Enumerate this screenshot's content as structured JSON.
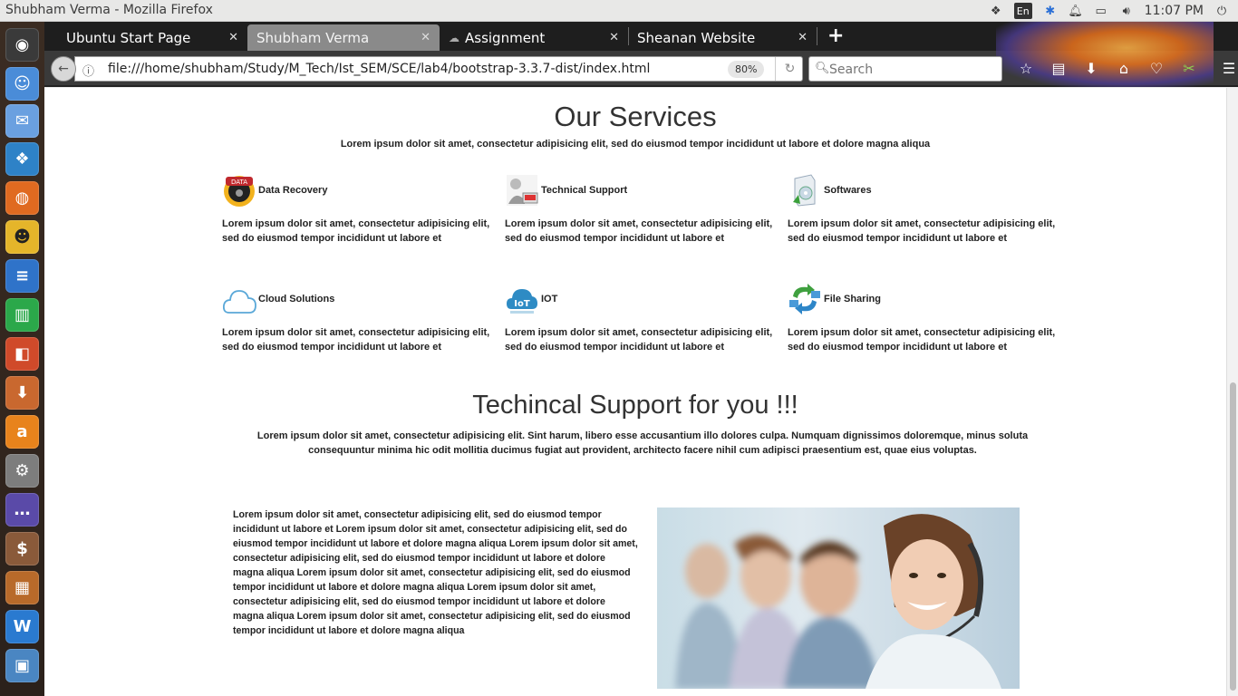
{
  "window": {
    "title": "Shubham Verma - Mozilla Firefox",
    "keyboard": "En",
    "clock": "11:07 PM"
  },
  "tabs": [
    {
      "label": "Ubuntu Start Page",
      "active": false
    },
    {
      "label": "Shubham Verma",
      "active": true
    },
    {
      "label": "Assignment",
      "active": false
    },
    {
      "label": "Sheanan Website",
      "active": false
    }
  ],
  "nav": {
    "url": "file:///home/shubham/Study/M_Tech/Ist_SEM/SCE/lab4/bootstrap-3.3.7-dist/index.html",
    "zoom": "80%",
    "search_placeholder": "Search"
  },
  "page": {
    "services_title": "Our Services",
    "services_subtitle": "Lorem ipsum dolor sit amet, consectetur adipisicing elit, sed do eiusmod tempor incididunt ut labore et dolore magna aliqua",
    "services": [
      {
        "name": "Data Recovery",
        "desc": "Lorem ipsum dolor sit amet, consectetur adipisicing elit, sed do eiusmod tempor incididunt ut labore et",
        "icon": "data-recovery-icon"
      },
      {
        "name": "Technical Support",
        "desc": "Lorem ipsum dolor sit amet, consectetur adipisicing elit, sed do eiusmod tempor incididunt ut labore et",
        "icon": "technical-support-icon"
      },
      {
        "name": "Softwares",
        "desc": "Lorem ipsum dolor sit amet, consectetur adipisicing elit, sed do eiusmod tempor incididunt ut labore et",
        "icon": "software-box-icon"
      },
      {
        "name": "Cloud Solutions",
        "desc": "Lorem ipsum dolor sit amet, consectetur adipisicing elit, sed do eiusmod tempor incididunt ut labore et",
        "icon": "cloud-icon"
      },
      {
        "name": "IOT",
        "desc": "Lorem ipsum dolor sit amet, consectetur adipisicing elit, sed do eiusmod tempor incididunt ut labore et",
        "icon": "iot-cloud-icon"
      },
      {
        "name": "File Sharing",
        "desc": "Lorem ipsum dolor sit amet, consectetur adipisicing elit, sed do eiusmod tempor incididunt ut labore et",
        "icon": "file-sharing-icon"
      }
    ],
    "support_title": "Techincal Support for you !!!",
    "support_subtitle": "Lorem ipsum dolor sit amet, consectetur adipisicing elit. Sint harum, libero esse accusantium illo dolores culpa. Numquam dignissimos doloremque, minus soluta consequuntur minima hic odit mollitia ducimus fugiat aut provident, architecto facere nihil cum adipisci praesentium est, quae eius voluptas.",
    "support_body": "Lorem ipsum dolor sit amet, consectetur adipisicing elit, sed do eiusmod tempor incididunt ut labore et Lorem ipsum dolor sit amet, consectetur adipisicing elit, sed do eiusmod tempor incididunt ut labore et dolore magna aliqua Lorem ipsum dolor sit amet, consectetur adipisicing elit, sed do eiusmod tempor incididunt ut labore et dolore magna aliqua Lorem ipsum dolor sit amet, consectetur adipisicing elit, sed do eiusmod tempor incididunt ut labore et dolore magna aliqua Lorem ipsum dolor sit amet, consectetur adipisicing elit, sed do eiusmod tempor incididunt ut labore et dolore magna aliqua Lorem ipsum dolor sit amet, consectetur adipisicing elit, sed do eiusmod tempor incididunt ut labore et dolore magna aliqua"
  }
}
